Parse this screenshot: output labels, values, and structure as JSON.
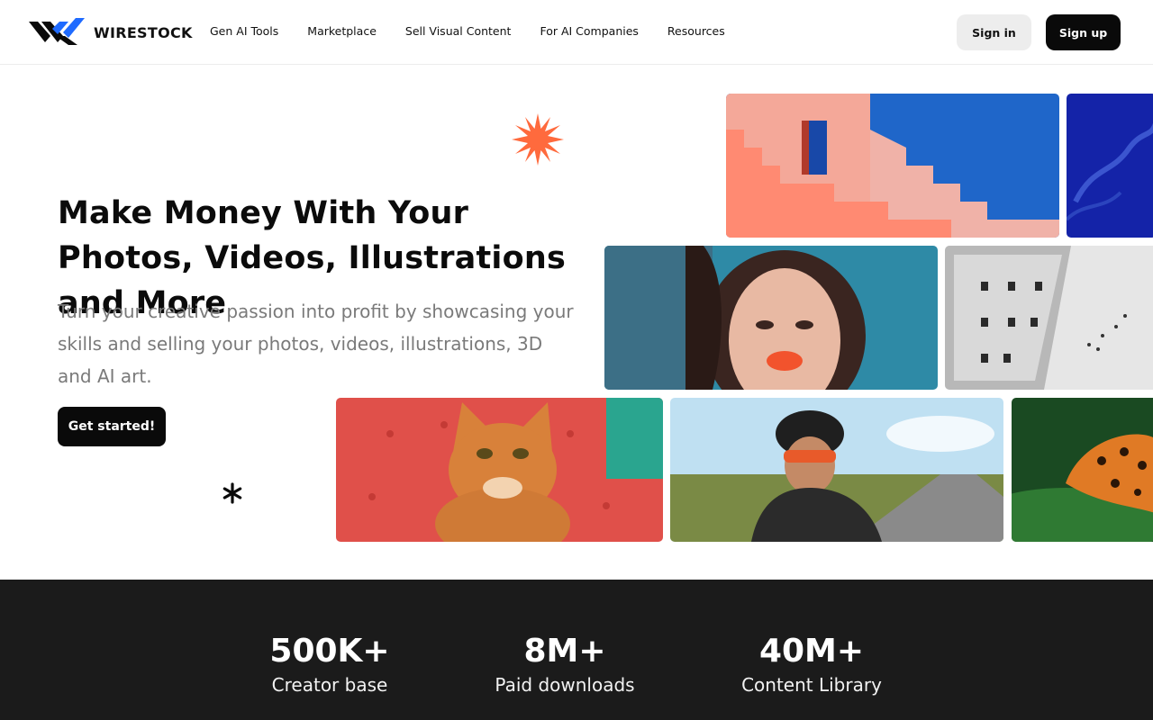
{
  "brand": {
    "name": "WIRESTOCK",
    "colors": {
      "dark": "#0a0a0a",
      "blue": "#1f6bff",
      "accent": "#ff6a3d"
    }
  },
  "nav": {
    "items": [
      "Gen AI Tools",
      "Marketplace",
      "Sell Visual Content",
      "For AI Companies",
      "Resources"
    ]
  },
  "auth": {
    "signin_label": "Sign in",
    "signup_label": "Sign up"
  },
  "hero": {
    "title": "Make Money With Your Photos, Videos, Illustrations and More",
    "subtitle": "Turn your creative passion into profit by showcasing your skills and selling your photos, videos, illustrations, 3D and AI art.",
    "cta_label": "Get started!"
  },
  "gallery": {
    "images": [
      "pink-stairs-architecture",
      "blue-jellyfish",
      "woman-portrait-freckles",
      "white-building-birds",
      "orange-cat-red-sofa",
      "cyclist-sunglasses-road",
      "orange-butterfly-leaf"
    ]
  },
  "stats": [
    {
      "value": "500K+",
      "label": "Creator base"
    },
    {
      "value": "8M+",
      "label": "Paid downloads"
    },
    {
      "value": "40M+",
      "label": "Content Library"
    }
  ]
}
